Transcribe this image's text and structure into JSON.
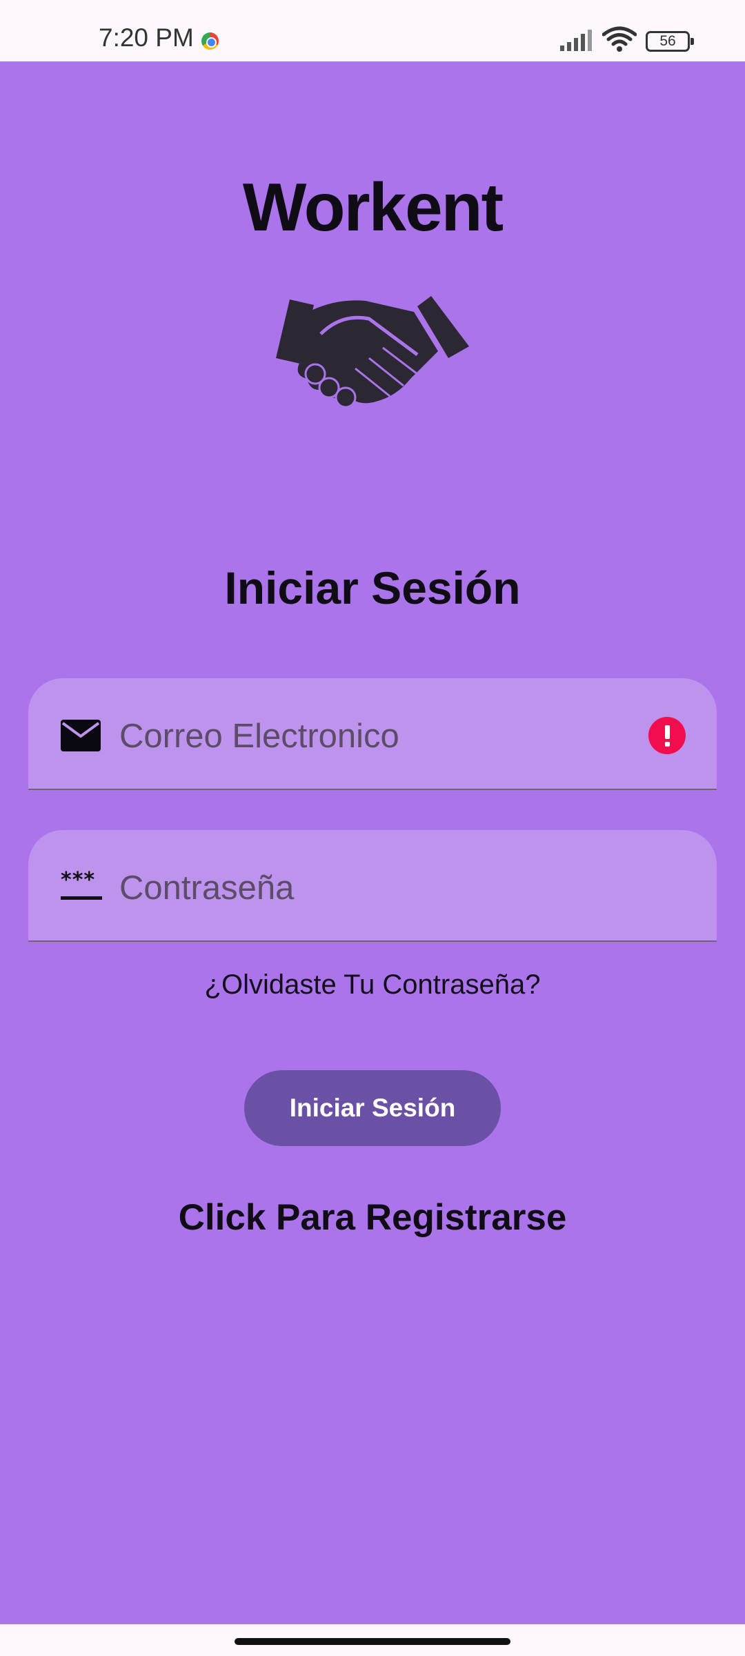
{
  "status_bar": {
    "time": "7:20 PM",
    "battery_level": "56",
    "icons": [
      "chrome-icon",
      "signal-icon",
      "wifi-icon",
      "battery-icon"
    ]
  },
  "app": {
    "title": "Workent",
    "logo_icon": "handshake-icon",
    "background_color": "#ab74ea"
  },
  "login": {
    "heading": "Iniciar Sesión",
    "email_field": {
      "placeholder": "Correo Electronico",
      "value": "",
      "icon": "mail-icon",
      "error_icon": "error-icon",
      "error_color": "#f20e4e"
    },
    "password_field": {
      "placeholder": "Contraseña",
      "value": "",
      "icon": "password-icon"
    },
    "forgot_password_label": "¿Olvidaste Tu Contraseña?",
    "submit_label": "Iniciar Sesión",
    "submit_color": "#6a51a6",
    "register_label": "Click Para Registrarse"
  }
}
